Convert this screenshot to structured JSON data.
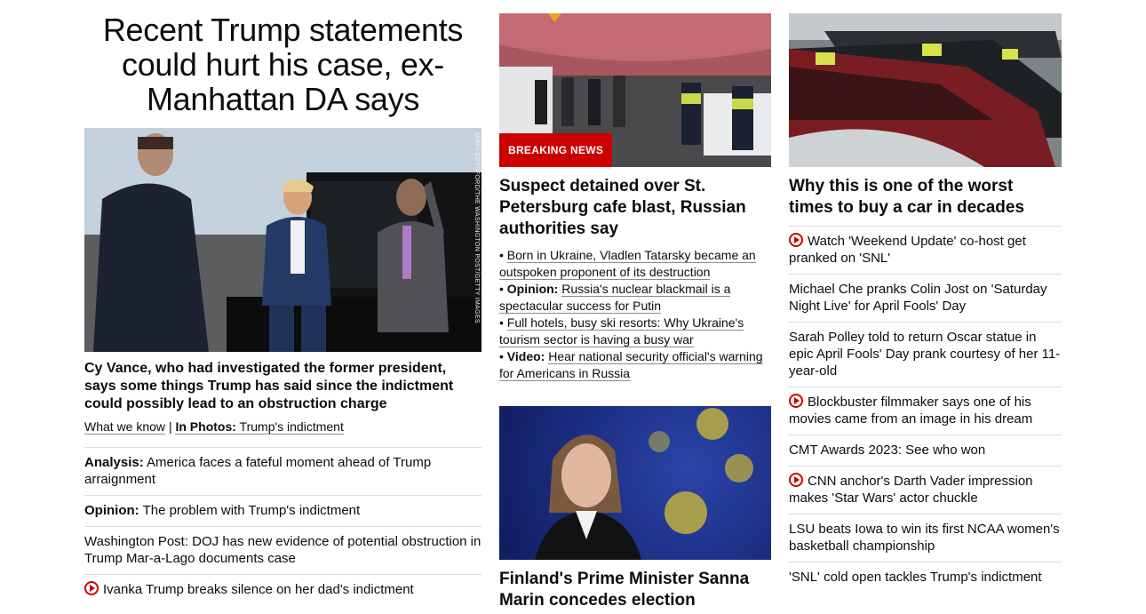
{
  "left": {
    "headline": "Recent Trump statements could hurt his case, ex-Manhattan DA says",
    "photo_credit": "JABIN BOTSFORD/THE WASHINGTON POST/GETTY IMAGES",
    "subheadline": "Cy Vance, who had investigated the former president, says some things Trump has said since the indictment could possibly lead to an obstruction charge",
    "links": {
      "what_we_know": "What we know",
      "separator": "|",
      "in_photos_label": "In Photos:",
      "in_photos_text": "Trump's indictment"
    },
    "stories": [
      {
        "prefix": "Analysis:",
        "text": "America faces a fateful moment ahead of Trump arraignment"
      },
      {
        "prefix": "Opinion:",
        "text": "The problem with Trump's indictment"
      },
      {
        "prefix": "",
        "text": "Washington Post: DOJ has new evidence of potential obstruction in Trump Mar-a-Lago documents case"
      },
      {
        "prefix": "",
        "text": "Ivanka Trump breaks silence on her dad's indictment",
        "icon": "play-icon"
      }
    ]
  },
  "middle": {
    "badge": "BREAKING NEWS",
    "headline": "Suspect detained over St. Petersburg cafe blast, Russian authorities say",
    "bullets": [
      {
        "bullet": "•",
        "prefix": "",
        "text": "Born in Ukraine, Vladlen Tatarsky became an outspoken proponent of its destruction"
      },
      {
        "bullet": "•",
        "prefix": "Opinion:",
        "text": "Russia's nuclear blackmail is a spectacular success for Putin"
      },
      {
        "bullet": "•",
        "prefix": "",
        "text": "Full hotels, busy ski resorts: Why Ukraine's tourism sector is having a busy war"
      },
      {
        "bullet": "•",
        "prefix": "Video:",
        "text": "Hear national security official's warning for Americans in Russia"
      }
    ],
    "second_headline": "Finland's Prime Minister Sanna Marin concedes election"
  },
  "right": {
    "headline": "Why this is one of the worst times to buy a car in decades",
    "items": [
      {
        "text": "Watch 'Weekend Update' co-host get pranked on 'SNL'",
        "icon": "play-icon"
      },
      {
        "text": "Michael Che pranks Colin Jost on 'Saturday Night Live' for April Fools' Day"
      },
      {
        "text": "Sarah Polley told to return Oscar statue in epic April Fools' Day prank courtesy of her 11-year-old"
      },
      {
        "text": "Blockbuster filmmaker says one of his movies came from an image in his dream",
        "icon": "play-icon"
      },
      {
        "text": "CMT Awards 2023: See who won"
      },
      {
        "text": "CNN anchor's Darth Vader impression makes 'Star Wars' actor chuckle",
        "icon": "play-icon"
      },
      {
        "text": "LSU beats Iowa to win its first NCAA women's basketball championship"
      },
      {
        "text": "'SNL' cold open tackles Trump's indictment"
      }
    ]
  },
  "colors": {
    "accent_red": "#cc0000",
    "divider": "#dcdcdc",
    "text": "#0c0c0c"
  }
}
